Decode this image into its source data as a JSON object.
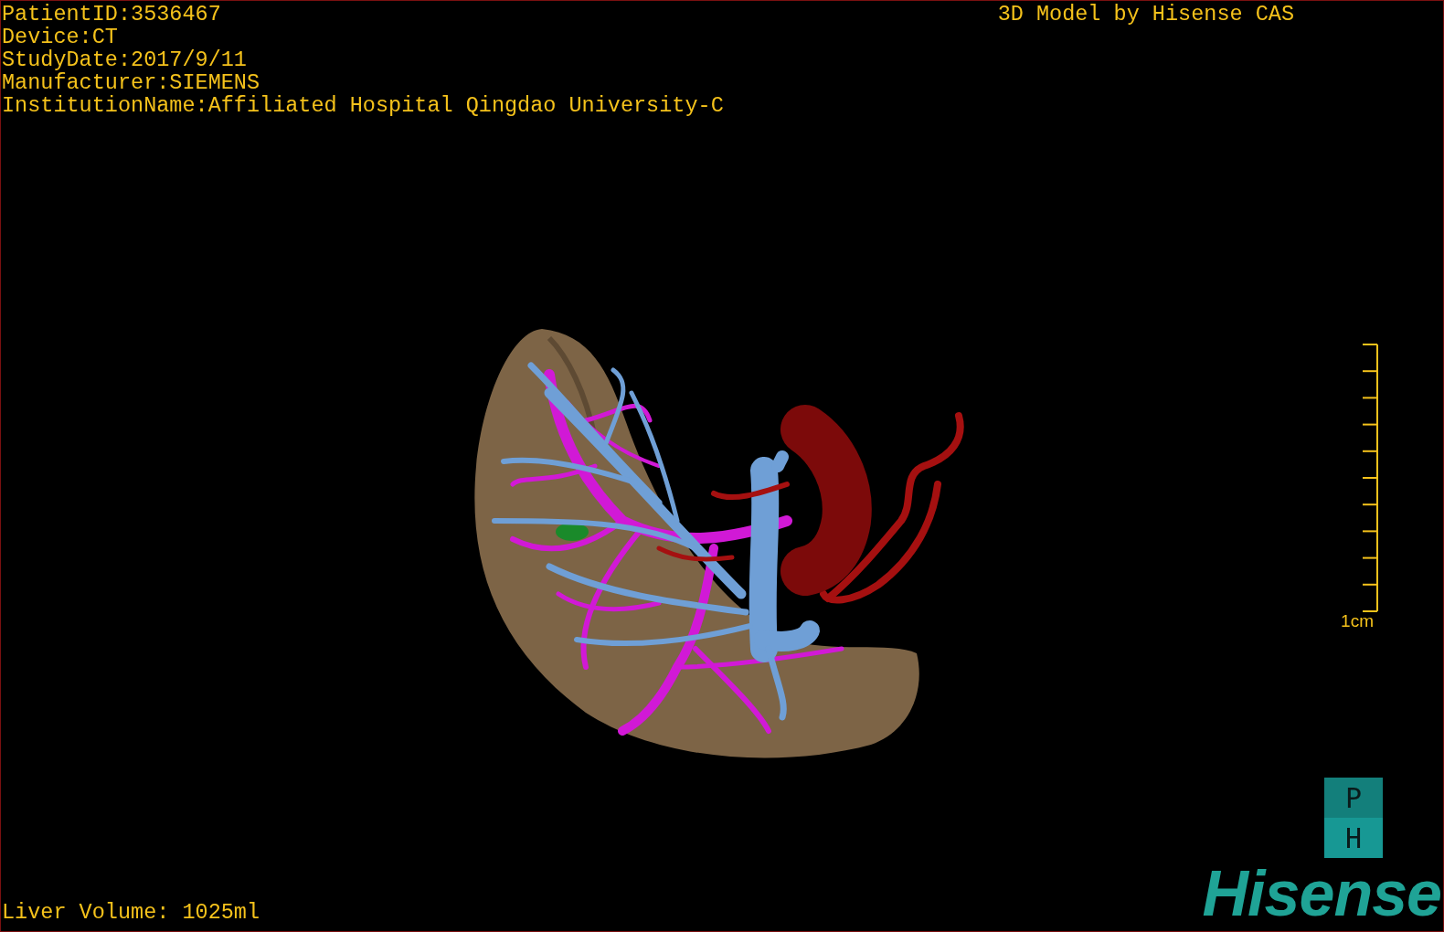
{
  "study_info": [
    "PatientID:3536467",
    "Device:CT",
    "StudyDate:2017/9/11",
    "Manufacturer:SIEMENS",
    "InstitutionName:Affiliated Hospital Qingdao University-C"
  ],
  "model_title": "3D Model by Hisense CAS",
  "scale_bar": {
    "label": "1cm"
  },
  "liver_volume": "Liver Volume: 1025ml",
  "logo": {
    "letters": [
      "P",
      "H"
    ],
    "brand": "Hisense"
  }
}
